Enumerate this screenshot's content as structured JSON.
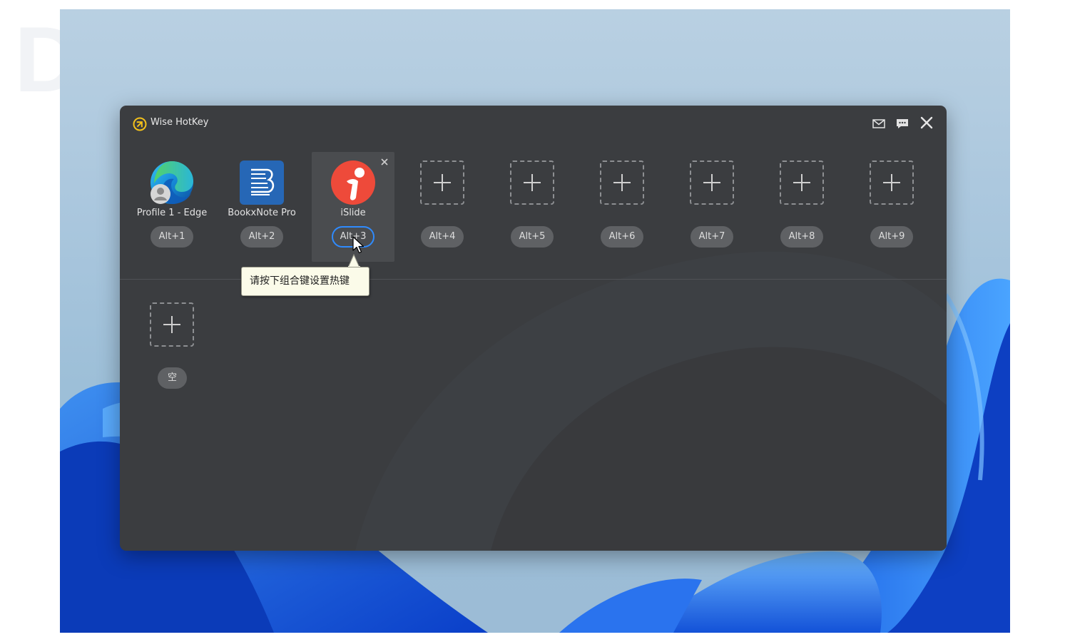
{
  "window": {
    "title": "Wise HotKey",
    "header_icons": [
      "mail-icon",
      "chat-icon",
      "close-icon"
    ]
  },
  "slots": [
    {
      "label": "Profile 1 - Edge",
      "hotkey": "Alt+1",
      "icon": "edge-profile-icon"
    },
    {
      "label": "BookxNote Pro",
      "hotkey": "Alt+2",
      "icon": "bookxnote-icon"
    },
    {
      "label": "iSlide",
      "hotkey": "Alt+3",
      "icon": "islide-icon",
      "state": "editing"
    },
    {
      "label": "",
      "hotkey": "Alt+4",
      "icon": "add-icon"
    },
    {
      "label": "",
      "hotkey": "Alt+5",
      "icon": "add-icon"
    },
    {
      "label": "",
      "hotkey": "Alt+6",
      "icon": "add-icon"
    },
    {
      "label": "",
      "hotkey": "Alt+7",
      "icon": "add-icon"
    },
    {
      "label": "",
      "hotkey": "Alt+8",
      "icon": "add-icon"
    },
    {
      "label": "",
      "hotkey": "Alt+9",
      "icon": "add-icon"
    }
  ],
  "extra_slot": {
    "label": "",
    "hotkey": "空",
    "icon": "add-icon"
  },
  "tooltip": {
    "text": "请按下组合键设置热键"
  },
  "colors": {
    "window_bg": "#3b3d40",
    "pill_bg": "#5f6164",
    "editing_border": "#2f8bff",
    "tooltip_bg": "#fbfbe9"
  }
}
